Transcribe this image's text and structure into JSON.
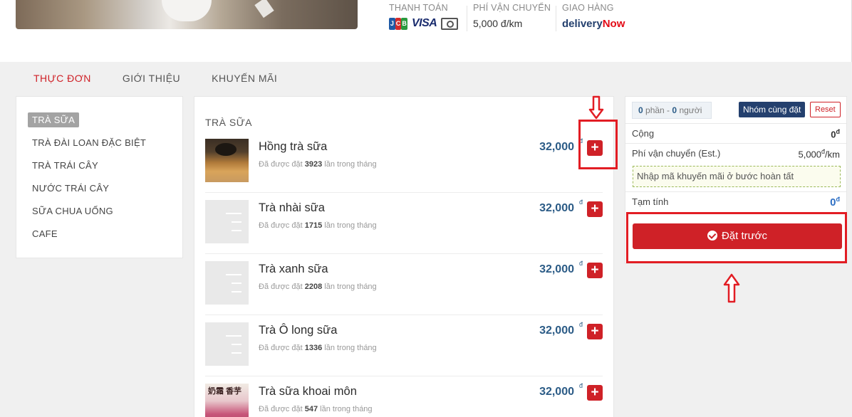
{
  "header": {
    "payment": {
      "label": "THANH TOÁN",
      "icons": [
        "jcb-icon",
        "visa-icon",
        "cash-icon"
      ],
      "jcb_letters": [
        "J",
        "C",
        "B"
      ],
      "visa_text": "VISA"
    },
    "shipping": {
      "label": "PHÍ VẬN CHUYỂN",
      "value": "5,000 đ/km"
    },
    "delivery": {
      "label": "GIAO HÀNG",
      "brand_part1": "delivery",
      "brand_part2": "Now"
    }
  },
  "tabs": [
    "THỰC ĐƠN",
    "GIỚI THIỆU",
    "KHUYẾN MÃI"
  ],
  "categories": [
    "TRÀ SỮA",
    "TRÀ ĐÀI LOAN ĐẶC BIỆT",
    "TRÀ TRÁI CÂY",
    "NƯỚC TRÁI CÂY",
    "SỮA CHUA UỐNG",
    "CAFE"
  ],
  "menu": {
    "section_title": "TRÀ SỮA",
    "items": [
      {
        "name": "Hồng trà sữa",
        "sold_prefix": "Đã được đặt",
        "sold_count": "3923",
        "sold_suffix": "lần trong tháng",
        "price": "32,000",
        "currency": "đ",
        "add": "+"
      },
      {
        "name": "Trà nhài sữa",
        "sold_prefix": "Đã được đặt",
        "sold_count": "1715",
        "sold_suffix": "lần trong tháng",
        "price": "32,000",
        "currency": "đ",
        "add": "+"
      },
      {
        "name": "Trà xanh sữa",
        "sold_prefix": "Đã được đặt",
        "sold_count": "2208",
        "sold_suffix": "lần trong tháng",
        "price": "32,000",
        "currency": "đ",
        "add": "+"
      },
      {
        "name": "Trà Ô long sữa",
        "sold_prefix": "Đã được đặt",
        "sold_count": "1336",
        "sold_suffix": "lần trong tháng",
        "price": "32,000",
        "currency": "đ",
        "add": "+"
      },
      {
        "name": "Trà sữa khoai môn",
        "sold_prefix": "Đã được đặt",
        "sold_count": "547",
        "sold_suffix": "lần trong tháng",
        "price": "32,000",
        "currency": "đ",
        "add": "+",
        "image_text": "奶霜 香芋"
      }
    ]
  },
  "cart": {
    "portions": "0",
    "portions_label": "phần -",
    "people": "0",
    "people_label": "người",
    "group_button": "Nhóm cùng đặt",
    "reset_button": "Reset",
    "subtotal_label": "Cộng",
    "subtotal_value": "0",
    "shipping_label": "Phí vận chuyển (Est.)",
    "shipping_value": "5,000",
    "shipping_unit": "/km",
    "promo_text": "Nhập mã khuyến mãi ở bước hoàn tất",
    "total_label": "Tạm tính",
    "total_value": "0",
    "currency": "đ",
    "order_button": "Đặt trước"
  },
  "colors": {
    "accent": "#cf2127",
    "price": "#2b5b86",
    "annotation": "#e21d24"
  }
}
